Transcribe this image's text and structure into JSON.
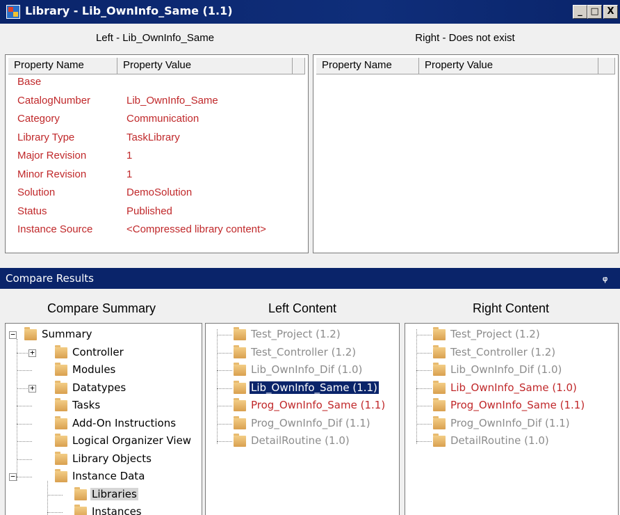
{
  "window": {
    "title": "Library - Lib_OwnInfo_Same (1.1)",
    "minimize_glyph": "_",
    "maximize_glyph": "□",
    "close_glyph": "X"
  },
  "left_panel": {
    "title": "Left - Lib_OwnInfo_Same",
    "col_name": "Property Name",
    "col_value": "Property Value",
    "rows": [
      {
        "name": "Base",
        "value": ""
      },
      {
        "name": "CatalogNumber",
        "value": "Lib_OwnInfo_Same"
      },
      {
        "name": "Category",
        "value": "Communication"
      },
      {
        "name": "Library Type",
        "value": "TaskLibrary"
      },
      {
        "name": "Major Revision",
        "value": "1"
      },
      {
        "name": "Minor Revision",
        "value": "1"
      },
      {
        "name": "Solution",
        "value": "DemoSolution"
      },
      {
        "name": "Status",
        "value": "Published"
      },
      {
        "name": "Instance Source",
        "value": "<Compressed library content>"
      }
    ]
  },
  "right_panel": {
    "title": "Right - Does not exist",
    "col_name": "Property Name",
    "col_value": "Property Value"
  },
  "compare_results": {
    "title": "Compare Results",
    "pin_glyph": "ᵩ",
    "summary_header": "Compare Summary",
    "left_header": "Left Content",
    "right_header": "Right Content"
  },
  "summary_tree": [
    {
      "label": "Summary",
      "expander": "−"
    },
    {
      "label": "Controller",
      "expander": "+"
    },
    {
      "label": "Modules",
      "expander": ""
    },
    {
      "label": "Datatypes",
      "expander": "+"
    },
    {
      "label": "Tasks",
      "expander": ""
    },
    {
      "label": "Add-On Instructions",
      "expander": ""
    },
    {
      "label": "Logical Organizer View",
      "expander": ""
    },
    {
      "label": "Library Objects",
      "expander": ""
    },
    {
      "label": "Instance Data",
      "expander": "−"
    },
    {
      "label": "Libraries",
      "expander": ""
    },
    {
      "label": "Instances",
      "expander": ""
    }
  ],
  "left_content": [
    {
      "label": "Test_Project (1.2)",
      "state": "same"
    },
    {
      "label": "Test_Controller (1.2)",
      "state": "same"
    },
    {
      "label": "Lib_OwnInfo_Dif (1.0)",
      "state": "same"
    },
    {
      "label": "Lib_OwnInfo_Same (1.1)",
      "state": "selected"
    },
    {
      "label": "Prog_OwnInfo_Same (1.1)",
      "state": "diff"
    },
    {
      "label": "Prog_OwnInfo_Dif (1.1)",
      "state": "same"
    },
    {
      "label": "DetailRoutine (1.0)",
      "state": "same"
    }
  ],
  "right_content": [
    {
      "label": "Test_Project (1.2)",
      "state": "same"
    },
    {
      "label": "Test_Controller (1.2)",
      "state": "same"
    },
    {
      "label": "Lib_OwnInfo_Dif (1.0)",
      "state": "same"
    },
    {
      "label": "Lib_OwnInfo_Same (1.0)",
      "state": "diff"
    },
    {
      "label": "Prog_OwnInfo_Same (1.1)",
      "state": "diff"
    },
    {
      "label": "Prog_OwnInfo_Dif (1.1)",
      "state": "same"
    },
    {
      "label": "DetailRoutine (1.0)",
      "state": "same"
    }
  ],
  "colors": {
    "title_bar": "#0a246a",
    "diff_text": "#c0282a",
    "same_text": "#8c8c8c",
    "folder": "#e7b86c"
  }
}
